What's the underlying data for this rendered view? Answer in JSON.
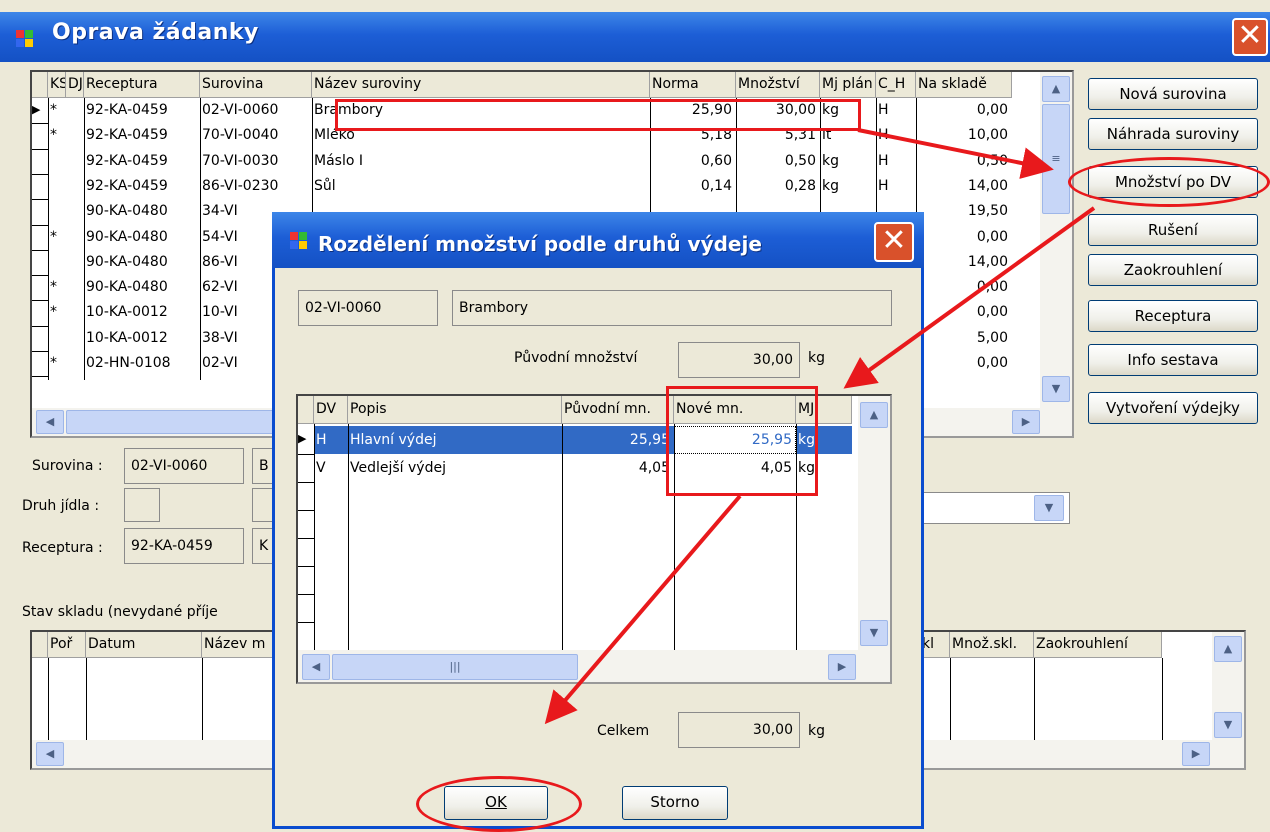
{
  "window": {
    "title": "Oprava žádanky"
  },
  "main_table": {
    "headers": [
      "KS",
      "DJ",
      "Receptura",
      "Surovina",
      "Název suroviny",
      "Norma",
      "Množství",
      "Mj plán",
      "C_H",
      "Na skladě"
    ],
    "rows": [
      {
        "ks": "*",
        "dj": "",
        "receptura": "92-KA-0459",
        "surovina": "02-VI-0060",
        "nazev": "Brambory",
        "norma": "25,90",
        "mnozstvi": "30,00",
        "mj": "kg",
        "ch": "H",
        "sklad": "0,00"
      },
      {
        "ks": "*",
        "dj": "",
        "receptura": "92-KA-0459",
        "surovina": "70-VI-0040",
        "nazev": "Mléko",
        "norma": "5,18",
        "mnozstvi": "5,31",
        "mj": "lt",
        "ch": "H",
        "sklad": "10,00"
      },
      {
        "ks": "",
        "dj": "",
        "receptura": "92-KA-0459",
        "surovina": "70-VI-0030",
        "nazev": "Máslo I",
        "norma": "0,60",
        "mnozstvi": "0,50",
        "mj": "kg",
        "ch": "H",
        "sklad": "0,50"
      },
      {
        "ks": "",
        "dj": "",
        "receptura": "92-KA-0459",
        "surovina": "86-VI-0230",
        "nazev": "Sůl",
        "norma": "0,14",
        "mnozstvi": "0,28",
        "mj": "kg",
        "ch": "H",
        "sklad": "14,00"
      },
      {
        "ks": "",
        "dj": "",
        "receptura": "90-KA-0480",
        "surovina": "34-VI",
        "nazev": "",
        "norma": "",
        "mnozstvi": "",
        "mj": "",
        "ch": "",
        "sklad": "19,50"
      },
      {
        "ks": "*",
        "dj": "",
        "receptura": "90-KA-0480",
        "surovina": "54-VI",
        "nazev": "",
        "norma": "",
        "mnozstvi": "",
        "mj": "",
        "ch": "",
        "sklad": "0,00"
      },
      {
        "ks": "",
        "dj": "",
        "receptura": "90-KA-0480",
        "surovina": "86-VI",
        "nazev": "",
        "norma": "",
        "mnozstvi": "",
        "mj": "",
        "ch": "",
        "sklad": "14,00"
      },
      {
        "ks": "*",
        "dj": "",
        "receptura": "90-KA-0480",
        "surovina": "62-VI",
        "nazev": "",
        "norma": "",
        "mnozstvi": "",
        "mj": "",
        "ch": "",
        "sklad": "0,00"
      },
      {
        "ks": "*",
        "dj": "",
        "receptura": "10-KA-0012",
        "surovina": "10-VI",
        "nazev": "",
        "norma": "",
        "mnozstvi": "",
        "mj": "",
        "ch": "",
        "sklad": "0,00"
      },
      {
        "ks": "",
        "dj": "",
        "receptura": "10-KA-0012",
        "surovina": "38-VI",
        "nazev": "",
        "norma": "",
        "mnozstvi": "",
        "mj": "",
        "ch": "",
        "sklad": "5,00"
      },
      {
        "ks": "*",
        "dj": "",
        "receptura": "02-HN-0108",
        "surovina": "02-VI",
        "nazev": "",
        "norma": "",
        "mnozstvi": "",
        "mj": "",
        "ch": "",
        "sklad": "0,00"
      }
    ]
  },
  "buttons": {
    "nova": "Nová surovina",
    "nahrada": "Náhrada suroviny",
    "mnozstvi_dv": "Množství po DV",
    "ruseni": "Rušení",
    "zaokrouhleni": "Zaokrouhlení",
    "receptura": "Receptura",
    "info": "Info sestava",
    "vytvoreni": "Vytvoření výdejky"
  },
  "detail": {
    "surovina_label": "Surovina :",
    "surovina_value": "02-VI-0060",
    "surovina_name": "B",
    "druh_label": "Druh jídla :",
    "receptura_label": "Receptura :",
    "receptura_value": "92-KA-0459",
    "receptura_name": "K"
  },
  "stock": {
    "label": "Stav skladu  (nevydané příje",
    "headers": [
      "Poř",
      "Datum",
      "Název m"
    ],
    "headers_right": [
      "kl",
      "Množ.skl.",
      "Zaokrouhlení"
    ]
  },
  "dialog": {
    "title": "Rozdělení množství podle druhů výdeje",
    "code": "02-VI-0060",
    "name": "Brambory",
    "orig_label": "Původní množství",
    "orig_value": "30,00",
    "orig_unit": "kg",
    "headers": [
      "DV",
      "Popis",
      "Původní mn.",
      "Nové mn.",
      "MJ"
    ],
    "rows": [
      {
        "dv": "H",
        "popis": "Hlavní výdej",
        "puvodni": "25,95",
        "nove": "25,95",
        "mj": "kg"
      },
      {
        "dv": "V",
        "popis": "Vedlejší výdej",
        "puvodni": "4,05",
        "nove": "4,05",
        "mj": "kg"
      }
    ],
    "total_label": "Celkem",
    "total_value": "30,00",
    "total_unit": "kg",
    "ok_label": "OK",
    "storno_label": "Storno"
  },
  "colors": {
    "title_blue": "#1d5ed6",
    "annotation_red": "#e8191c",
    "selection": "#316ac5"
  }
}
